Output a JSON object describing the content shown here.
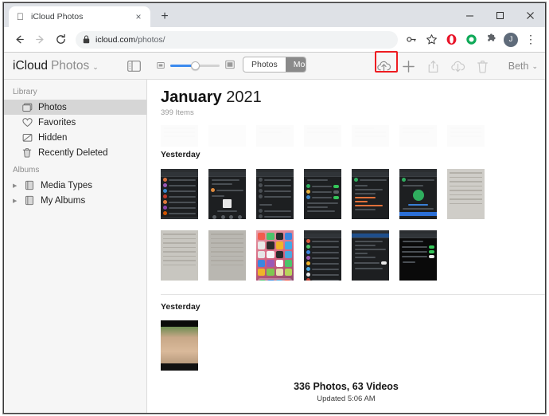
{
  "browser": {
    "tab": {
      "title": "iCloud Photos",
      "favicon": "apple-icon",
      "close_label": "×"
    },
    "new_tab_label": "+",
    "window_controls": {
      "minimize": "─",
      "maximize": "□",
      "close": "✕"
    },
    "nav": {
      "back": "←",
      "forward": "→",
      "reload": "↻"
    },
    "omnibox": {
      "lock": "lock-icon",
      "url_domain": "icloud.com",
      "url_path": "/photos/"
    },
    "toolbar_icons": [
      "password-key-icon",
      "bookmark-star-icon",
      "opera-extension-icon",
      "green-circle-extension-icon",
      "puzzle-extension-icon"
    ],
    "profile_initial": "J",
    "menu_label": "⋮"
  },
  "app": {
    "brand": {
      "icloud": "iCloud",
      "name": "Photos",
      "caret": "⌄"
    },
    "sidebar_toggle": "sidebar-toggle-icon",
    "zoom_slider": {
      "small_icon": "small-thumbnails-icon",
      "large_icon": "large-thumbnails-icon",
      "value": 56
    },
    "segmented": [
      {
        "label": "Photos",
        "selected": false
      },
      {
        "label": "Moments",
        "selected": true
      }
    ],
    "actions": [
      {
        "name": "upload-button",
        "icon": "cloud-upload-icon",
        "enabled": true,
        "highlighted": true
      },
      {
        "name": "add-button",
        "icon": "plus-icon",
        "enabled": true,
        "highlighted": false
      },
      {
        "name": "share-button",
        "icon": "share-icon",
        "enabled": false,
        "highlighted": false
      },
      {
        "name": "download-button",
        "icon": "cloud-download-icon",
        "enabled": false,
        "highlighted": false
      },
      {
        "name": "delete-button",
        "icon": "trash-icon",
        "enabled": false,
        "highlighted": false
      }
    ],
    "account": {
      "name": "Beth",
      "caret": "⌄"
    }
  },
  "sidebar": {
    "groups": [
      {
        "title": "Library",
        "items": [
          {
            "label": "Photos",
            "icon": "photos-icon",
            "selected": true
          },
          {
            "label": "Favorites",
            "icon": "heart-icon",
            "selected": false
          },
          {
            "label": "Hidden",
            "icon": "hidden-icon",
            "selected": false
          },
          {
            "label": "Recently Deleted",
            "icon": "trash-icon",
            "selected": false
          }
        ]
      },
      {
        "title": "Albums",
        "items": [
          {
            "label": "Media Types",
            "icon": "album-icon",
            "selected": false,
            "disclosure": "▶"
          },
          {
            "label": "My Albums",
            "icon": "album-icon",
            "selected": false,
            "disclosure": "▶"
          }
        ]
      }
    ]
  },
  "content": {
    "month": "January",
    "year": "2021",
    "item_count": "399 Items",
    "sections": [
      {
        "label": "Yesterday",
        "photo_count": 13
      },
      {
        "label": "Yesterday",
        "photo_count": 1
      }
    ],
    "footer": {
      "count": "336 Photos, 63 Videos",
      "updated": "Updated 5:06 AM"
    }
  }
}
